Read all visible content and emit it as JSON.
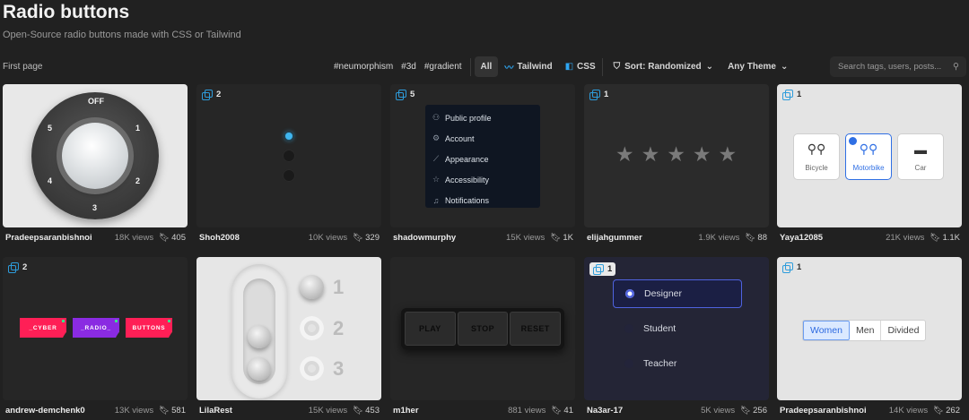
{
  "header": {
    "title": "Radio buttons",
    "subtitle": "Open-Source radio buttons made with CSS or Tailwind",
    "breadcrumb": "First page"
  },
  "toolbar": {
    "tags": [
      "#neumorphism",
      "#3d",
      "#gradient"
    ],
    "filter_all": "All",
    "filter_tailwind": "Tailwind",
    "filter_css": "CSS",
    "sort_label": "Sort: Randomized",
    "theme_label": "Any Theme",
    "search_placeholder": "Search tags, users, posts..."
  },
  "cards": [
    {
      "author": "Pradeepsaranbishnoi",
      "views": "18K views",
      "saves": "405",
      "count": "",
      "knob": {
        "off": "OFF",
        "labels": [
          "1",
          "2",
          "3",
          "4",
          "5"
        ]
      }
    },
    {
      "author": "Shoh2008",
      "views": "10K views",
      "saves": "329",
      "count": "2"
    },
    {
      "author": "shadowmurphy",
      "views": "15K views",
      "saves": "1K",
      "count": "5",
      "menu": [
        "Public profile",
        "Account",
        "Appearance",
        "Accessibility",
        "Notifications"
      ]
    },
    {
      "author": "elijahgummer",
      "views": "1.9K views",
      "saves": "88",
      "count": "1",
      "stars": 5
    },
    {
      "author": "Yaya12085",
      "views": "21K views",
      "saves": "1.1K",
      "count": "1",
      "vehicles": [
        "Bicycle",
        "Motorbike",
        "Car"
      ]
    },
    {
      "author": "andrew-demchenk0",
      "views": "13K views",
      "saves": "581",
      "count": "2",
      "buttons": [
        "_CYBER",
        "_RADIO_",
        "BUTTONS"
      ]
    },
    {
      "author": "LilaRest",
      "views": "15K views",
      "saves": "453",
      "count": "",
      "options": [
        "1",
        "2",
        "3"
      ]
    },
    {
      "author": "m1her",
      "views": "881 views",
      "saves": "41",
      "count": "",
      "buttons": [
        "PLAY",
        "STOP",
        "RESET"
      ]
    },
    {
      "author": "Na3ar-17",
      "views": "5K views",
      "saves": "256",
      "count": "1",
      "roles": [
        "Designer",
        "Student",
        "Teacher"
      ]
    },
    {
      "author": "Pradeepsaranbishnoi",
      "views": "14K views",
      "saves": "262",
      "count": "1",
      "segments": [
        "Women",
        "Men",
        "Divided"
      ]
    }
  ],
  "colors": {
    "background": "#212121",
    "accent": "#2d9cdb",
    "selected_blue": "#2f6fe4"
  }
}
